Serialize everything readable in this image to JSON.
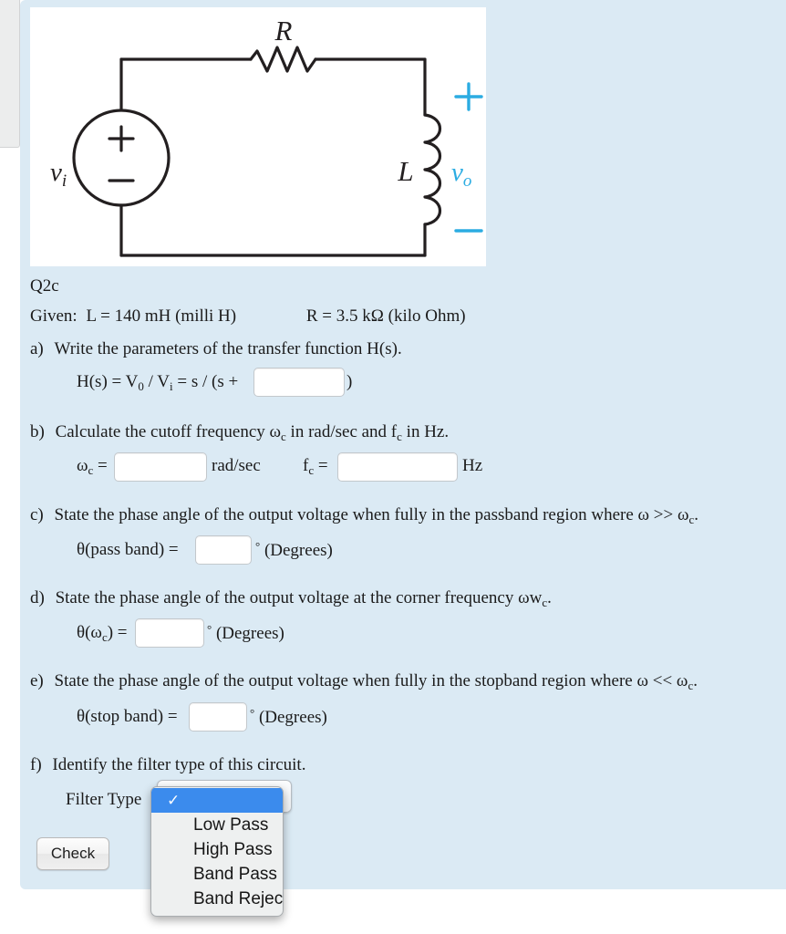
{
  "figure": {
    "name": "rl-high-pass-circuit",
    "labels": {
      "resistor": "R",
      "inductor": "L",
      "source": "v",
      "source_sub": "i",
      "source_plus": "+",
      "source_minus": "−",
      "output": "v",
      "output_sub": "o",
      "output_plus": "+",
      "output_minus": "−"
    },
    "accent_color": "#2bace2",
    "line_color": "#231f20",
    "panel_background": "#ffffff"
  },
  "question": {
    "id": "Q2c",
    "given_label": "Given:",
    "given_inductance": "L = 140 mH (milli H)",
    "given_resistance": "R = 3.5 kΩ (kilo Ohm)",
    "parts": {
      "a": {
        "marker": "a)",
        "prompt": "Write the parameters of the transfer function H(s).",
        "formula_pre": "H(s) = V",
        "formula_sub1": "0",
        "formula_mid": " / V",
        "formula_sub2": "i",
        "formula_post": " = s / (s +",
        "formula_close": ")",
        "input_value": ""
      },
      "b": {
        "marker": "b)",
        "prompt_pre": "Calculate the cutoff frequency ω",
        "prompt_sub1": "c",
        "prompt_mid": " in rad/sec and f",
        "prompt_sub2": "c",
        "prompt_post": " in Hz.",
        "omega_label": "ω",
        "omega_sub": "c",
        "omega_eq": " =",
        "omega_units": "rad/sec",
        "omega_value": "",
        "f_label": "f",
        "f_sub": "c",
        "f_eq": " =",
        "f_units": "Hz",
        "f_value": ""
      },
      "c": {
        "marker": "c)",
        "prompt_pre": "State the phase angle of the output voltage when fully in the passband region where ω >> ω",
        "prompt_sub": "c",
        "prompt_post": ".",
        "answer_label": "θ(pass band) =",
        "degrees_symbol": "°",
        "degrees_text": "(Degrees)",
        "input_value": ""
      },
      "d": {
        "marker": "d)",
        "prompt_pre": "State the phase angle of the output voltage at the corner frequency ωw",
        "prompt_sub": "c",
        "prompt_post": ".",
        "answer_label_pre": "θ(ω",
        "answer_label_sub": "c",
        "answer_label_post": ") =",
        "degrees_symbol": "°",
        "degrees_text": "(Degrees)",
        "input_value": ""
      },
      "e": {
        "marker": "e)",
        "prompt_pre": "State the phase angle of the output voltage when fully in the stopband region where ω << ω",
        "prompt_sub": "c",
        "prompt_post": ".",
        "answer_label": "θ(stop band) =",
        "degrees_symbol": "°",
        "degrees_text": "(Degrees)",
        "input_value": ""
      },
      "f": {
        "marker": "f)",
        "prompt": "Identify the filter type of this circuit.",
        "field_label": "Filter Type"
      }
    }
  },
  "filter_type_select": {
    "selected_value": "",
    "checkmark": "✓",
    "options": [
      {
        "label": "",
        "selected": true
      },
      {
        "label": "Low Pass",
        "selected": false
      },
      {
        "label": "High Pass",
        "selected": false
      },
      {
        "label": "Band Pass",
        "selected": false
      },
      {
        "label": "Band Reject",
        "selected": false
      }
    ],
    "highlight_color": "#3b8bed"
  },
  "actions": {
    "check_label": "Check"
  }
}
